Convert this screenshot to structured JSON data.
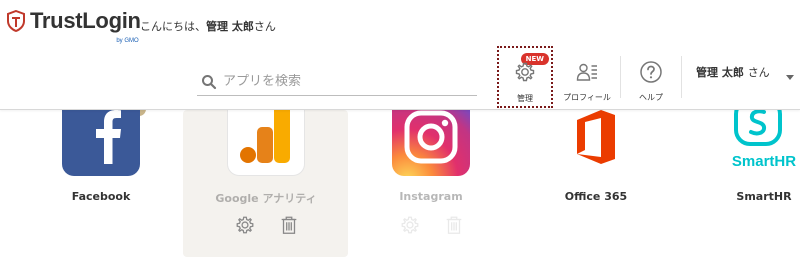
{
  "header": {
    "logo_text": "TrustLogin",
    "logo_sub": "by GMO",
    "greeting_prefix": "こんにちは、",
    "greeting_name": "管理 太郎",
    "greeting_suffix": "さん"
  },
  "search": {
    "placeholder": "アプリを検索",
    "icon": "search-icon"
  },
  "nav": {
    "admin": {
      "label": "管理",
      "badge": "NEW",
      "icon": "gear-icon"
    },
    "profile": {
      "label": "プロフィール",
      "icon": "profile-icon"
    },
    "help": {
      "label": "ヘルプ",
      "icon": "help-icon"
    }
  },
  "user_menu": {
    "name": "管理 太郎",
    "suffix": "さん"
  },
  "apps": [
    {
      "name": "Facebook",
      "icon": "facebook-icon",
      "color": "#3b5998"
    },
    {
      "name": "Google アナリティ",
      "icon": "google-analytics-icon",
      "color": "#f9ab00"
    },
    {
      "name": "Instagram",
      "icon": "instagram-icon",
      "color": "#c13584"
    },
    {
      "name": "Office 365",
      "icon": "office365-icon",
      "color": "#eb3c00"
    },
    {
      "name": "SmartHR",
      "icon": "smarthr-icon",
      "color": "#00c4cc"
    }
  ],
  "colors": {
    "new_badge": "#d9332c",
    "focus_border": "#7a1a1a",
    "card_bg": "#f4f2ee"
  }
}
